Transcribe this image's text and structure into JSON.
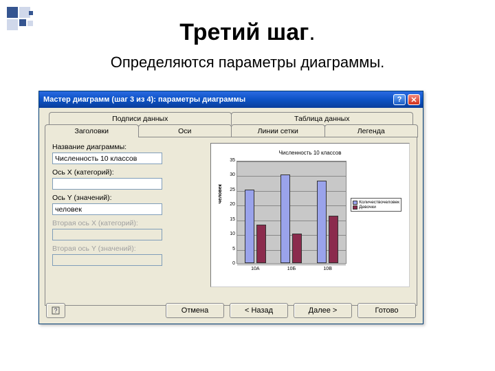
{
  "slide": {
    "title": "Третий шаг",
    "title_dot": ".",
    "subtitle": "Определяются параметры диаграммы."
  },
  "dialog": {
    "title": "Мастер диаграмм (шаг 3 из 4): параметры диаграммы",
    "help_icon": "?",
    "close_icon": "✕",
    "tabs_back": [
      "Подписи данных",
      "Таблица данных"
    ],
    "tabs_front": [
      "Заголовки",
      "Оси",
      "Линии сетки",
      "Легенда"
    ],
    "fields": {
      "chart_title_label": "Название диаграммы:",
      "chart_title_value": "Численность 10 классов",
      "x_label": "Ось X (категорий):",
      "x_value": "",
      "y_label": "Ось Y (значений):",
      "y_value": "человек",
      "x2_label": "Вторая ось X (категорий):",
      "x2_value": "",
      "y2_label": "Вторая ось Y (значений):",
      "y2_value": ""
    },
    "buttons": {
      "cancel": "Отмена",
      "back": "< Назад",
      "next": "Далее >",
      "finish": "Готово",
      "help": "?"
    }
  },
  "chart_data": {
    "type": "bar",
    "title": "Численность 10 классов",
    "ylabel": "человек",
    "categories": [
      "10А",
      "10Б",
      "10В"
    ],
    "series": [
      {
        "name": "Количествочеловек",
        "values": [
          25,
          30,
          28
        ]
      },
      {
        "name": "Девочки",
        "values": [
          13,
          10,
          16
        ]
      }
    ],
    "ylim": [
      0,
      35
    ],
    "yticks": [
      0,
      5,
      10,
      15,
      20,
      25,
      30,
      35
    ],
    "xlabel": ""
  }
}
